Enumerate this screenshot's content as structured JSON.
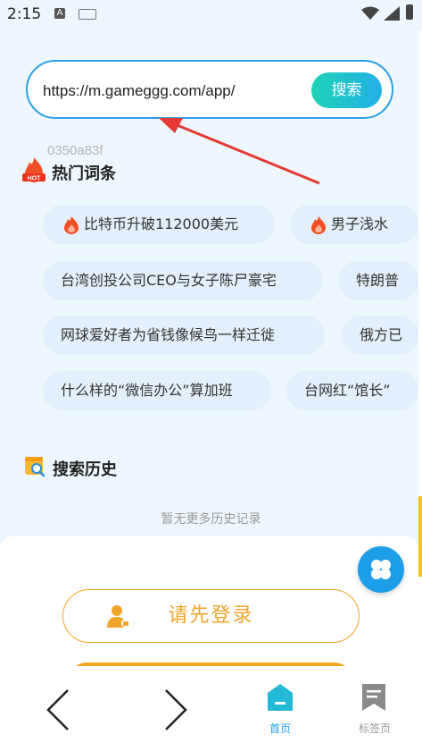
{
  "status_bar": {
    "time": "2:15",
    "a_badge": "A"
  },
  "search": {
    "url_value": "https://m.gameggg.com/app/",
    "button_label": "搜索"
  },
  "device_id": "0350a83f",
  "hot": {
    "title": "热门词条",
    "badge": "HOT",
    "rows": [
      [
        {
          "label": "比特币升破112000美元",
          "flame": true
        },
        {
          "label": "男子浅水",
          "flame": true
        }
      ],
      [
        {
          "label": "台湾创投公司CEO与女子陈尸豪宅",
          "flame": false
        },
        {
          "label": "特朗普",
          "flame": false
        }
      ],
      [
        {
          "label": "网球爱好者为省钱像候鸟一样迁徙",
          "flame": false
        },
        {
          "label": "俄方已",
          "flame": false
        }
      ],
      [
        {
          "label": "什么样的“微信办公”算加班",
          "flame": false
        },
        {
          "label": "台网红“馆长”",
          "flame": false
        }
      ]
    ]
  },
  "history": {
    "title": "搜索历史",
    "empty_text": "暂无更多历史记录"
  },
  "login": {
    "label": "请先登录"
  },
  "nav": {
    "home_label": "首页",
    "tabs_label": "标签页"
  },
  "colors": {
    "accent": "#1d9ee8",
    "orange": "#f0a42a",
    "annotation": "#e53935"
  }
}
